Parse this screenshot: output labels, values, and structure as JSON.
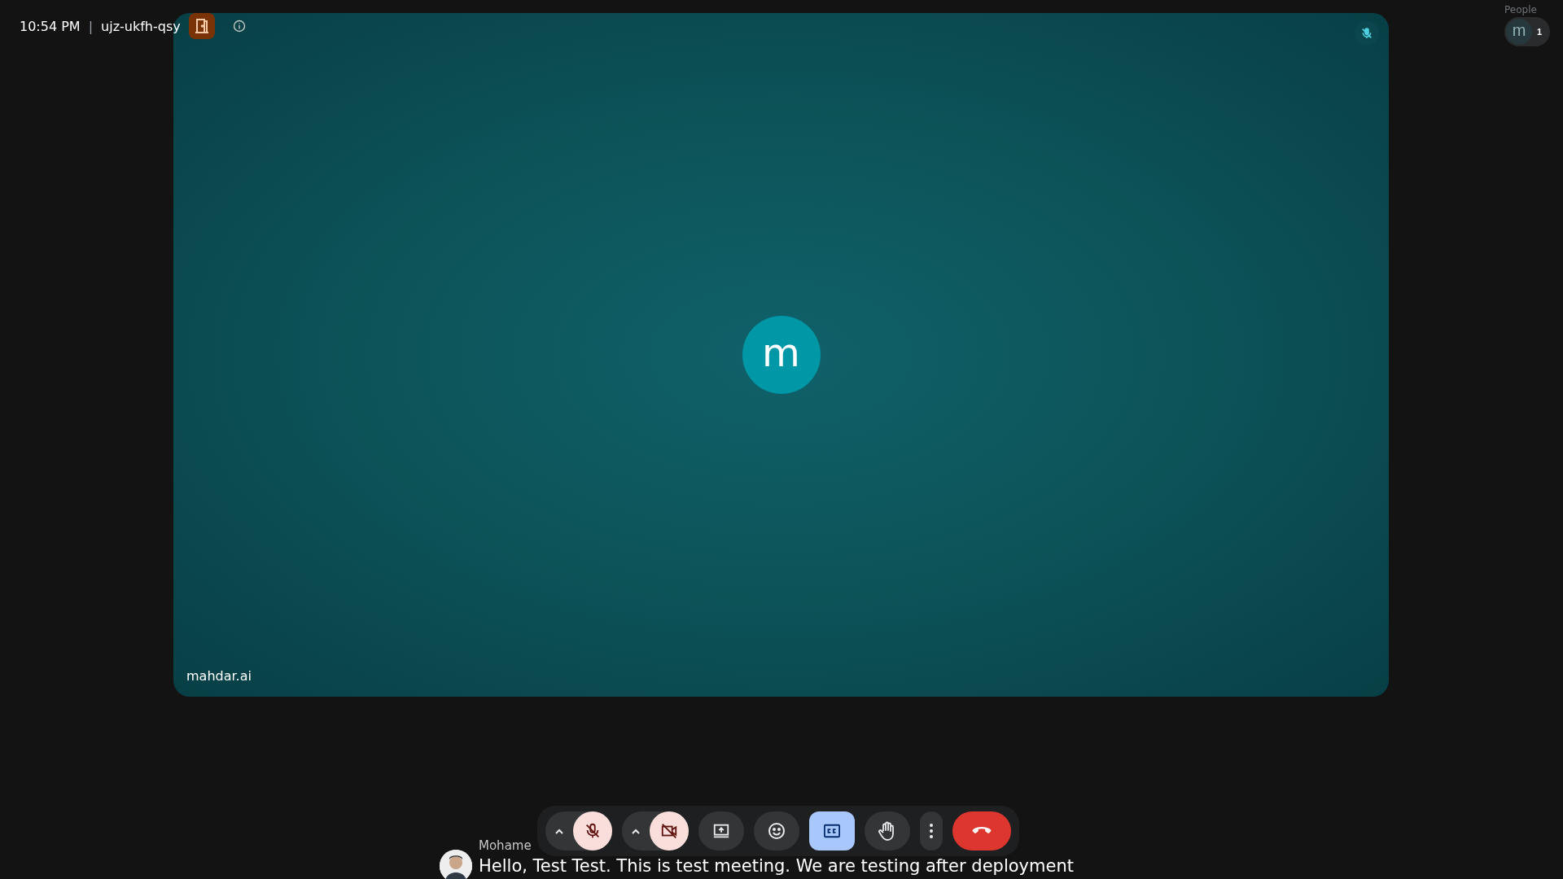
{
  "top_bar": {
    "time": "10:54 PM",
    "separator": "|",
    "meeting_code": "ujz-ukfh-qsy"
  },
  "tile": {
    "name": "mahdar.ai",
    "avatar_letter": "m",
    "muted": true
  },
  "people": {
    "label": "People",
    "avatar_letter": "m",
    "count": "1"
  },
  "toolbar": {
    "buttons": [
      {
        "kind": "mic",
        "muted": true
      },
      {
        "kind": "camera",
        "off": true
      },
      {
        "kind": "present"
      },
      {
        "kind": "emoji"
      },
      {
        "kind": "captions",
        "on": true
      },
      {
        "kind": "hand",
        "on": false
      },
      {
        "kind": "more"
      },
      {
        "kind": "end"
      }
    ]
  },
  "caption": {
    "speaker": "Mohame",
    "text": "Hello, Test Test. This is test meeting. We are testing after deployment"
  }
}
